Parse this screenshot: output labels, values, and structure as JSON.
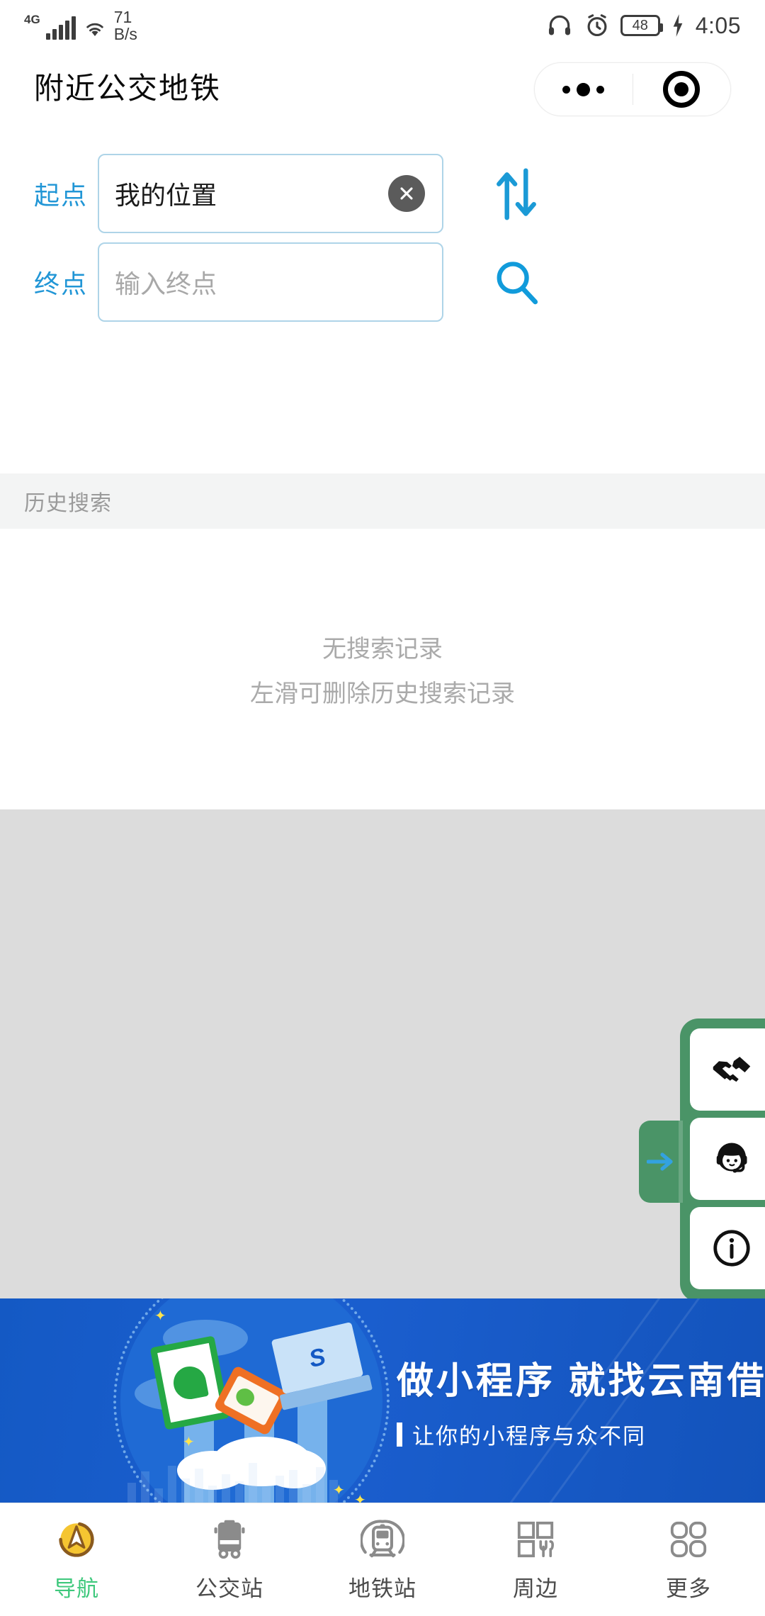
{
  "status_bar": {
    "network_type": "4G",
    "speed_value": "71",
    "speed_unit": "B/s",
    "headphone_icon": "headphone-icon",
    "alarm_icon": "alarm-icon",
    "battery_level": "48",
    "charging_icon": "charging-bolt-icon",
    "time": "4:05"
  },
  "navbar": {
    "title": "附近公交地铁",
    "capsule": {
      "more_icon": "more-dots-icon",
      "target_icon": "target-circle-icon"
    }
  },
  "form": {
    "origin": {
      "label": "起点",
      "value": "我的位置",
      "placeholder": "我的位置",
      "clear_icon": "close-circle-icon"
    },
    "destination": {
      "label": "终点",
      "value": "",
      "placeholder": "输入终点"
    },
    "swap_icon": "swap-arrows-icon",
    "search_icon": "search-icon",
    "accent_color": "#2196d6",
    "field_border_color": "#aed4e8"
  },
  "history": {
    "section_title": "历史搜索",
    "empty_primary": "无搜索记录",
    "empty_secondary": "左滑可删除历史搜索记录"
  },
  "side_panel": {
    "collapse_icon": "arrow-right-icon",
    "panel_color": "#4a9467",
    "buttons": [
      {
        "icon": "handshake-icon",
        "name": "cooperation-button"
      },
      {
        "icon": "headset-support-icon",
        "name": "customer-service-button"
      },
      {
        "icon": "info-circle-icon",
        "name": "about-button"
      }
    ]
  },
  "banner": {
    "title": "做小程序  就找云南借行",
    "subtitle": "让你的小程序与众不同",
    "bg_color": "#1459c4",
    "illustration": "miniprogram-devices-illustration"
  },
  "tabbar": {
    "items": [
      {
        "label": "导航",
        "icon": "compass-navigation-icon",
        "active": true
      },
      {
        "label": "公交站",
        "icon": "bus-icon",
        "active": false
      },
      {
        "label": "地铁站",
        "icon": "subway-train-icon",
        "active": false
      },
      {
        "label": "周边",
        "icon": "grid-food-icon",
        "active": false
      },
      {
        "label": "更多",
        "icon": "four-squares-icon",
        "active": false
      }
    ],
    "active_color": "#3ec87c",
    "inactive_color": "#4b4b4b"
  }
}
